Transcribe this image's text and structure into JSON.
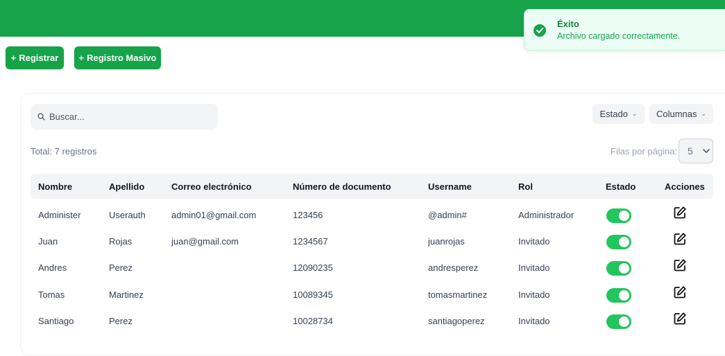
{
  "buttons": {
    "registrar": "Registrar",
    "masivo": "Registro Masivo"
  },
  "toast": {
    "title": "Éxito",
    "message": "Archivo cargado correctamente."
  },
  "search": {
    "placeholder": "Buscar..."
  },
  "filters": {
    "estado": "Estado",
    "columnas": "Columnas"
  },
  "total": "Total: 7 registros",
  "pagination": {
    "label": "Filas por página:",
    "value": "5"
  },
  "table": {
    "headers": {
      "nombre": "Nombre",
      "apellido": "Apellido",
      "correo": "Correo electrónico",
      "documento": "Número de documento",
      "username": "Username",
      "rol": "Rol",
      "estado": "Estado",
      "acciones": "Acciones"
    },
    "rows": [
      {
        "nombre": "Administer",
        "apellido": "Userauth",
        "correo": "admin01@gmail.com",
        "documento": "123456",
        "username": "@admin#",
        "rol": "Administrador",
        "activo": true
      },
      {
        "nombre": "Juan",
        "apellido": "Rojas",
        "correo": "juan@gmail.com",
        "documento": "1234567",
        "username": "juanrojas",
        "rol": "Invitado",
        "activo": true
      },
      {
        "nombre": "Andres",
        "apellido": "Perez",
        "correo": "",
        "documento": "12090235",
        "username": "andresperez",
        "rol": "Invitado",
        "activo": true
      },
      {
        "nombre": "Tomas",
        "apellido": "Martinez",
        "correo": "",
        "documento": "10089345",
        "username": "tomasmartinez",
        "rol": "Invitado",
        "activo": true
      },
      {
        "nombre": "Santiago",
        "apellido": "Perez",
        "correo": "",
        "documento": "10028734",
        "username": "santiagoperez",
        "rol": "Invitado",
        "activo": true
      }
    ]
  },
  "colors": {
    "brand": "#16a34a",
    "toggle_on": "#22c55e"
  }
}
